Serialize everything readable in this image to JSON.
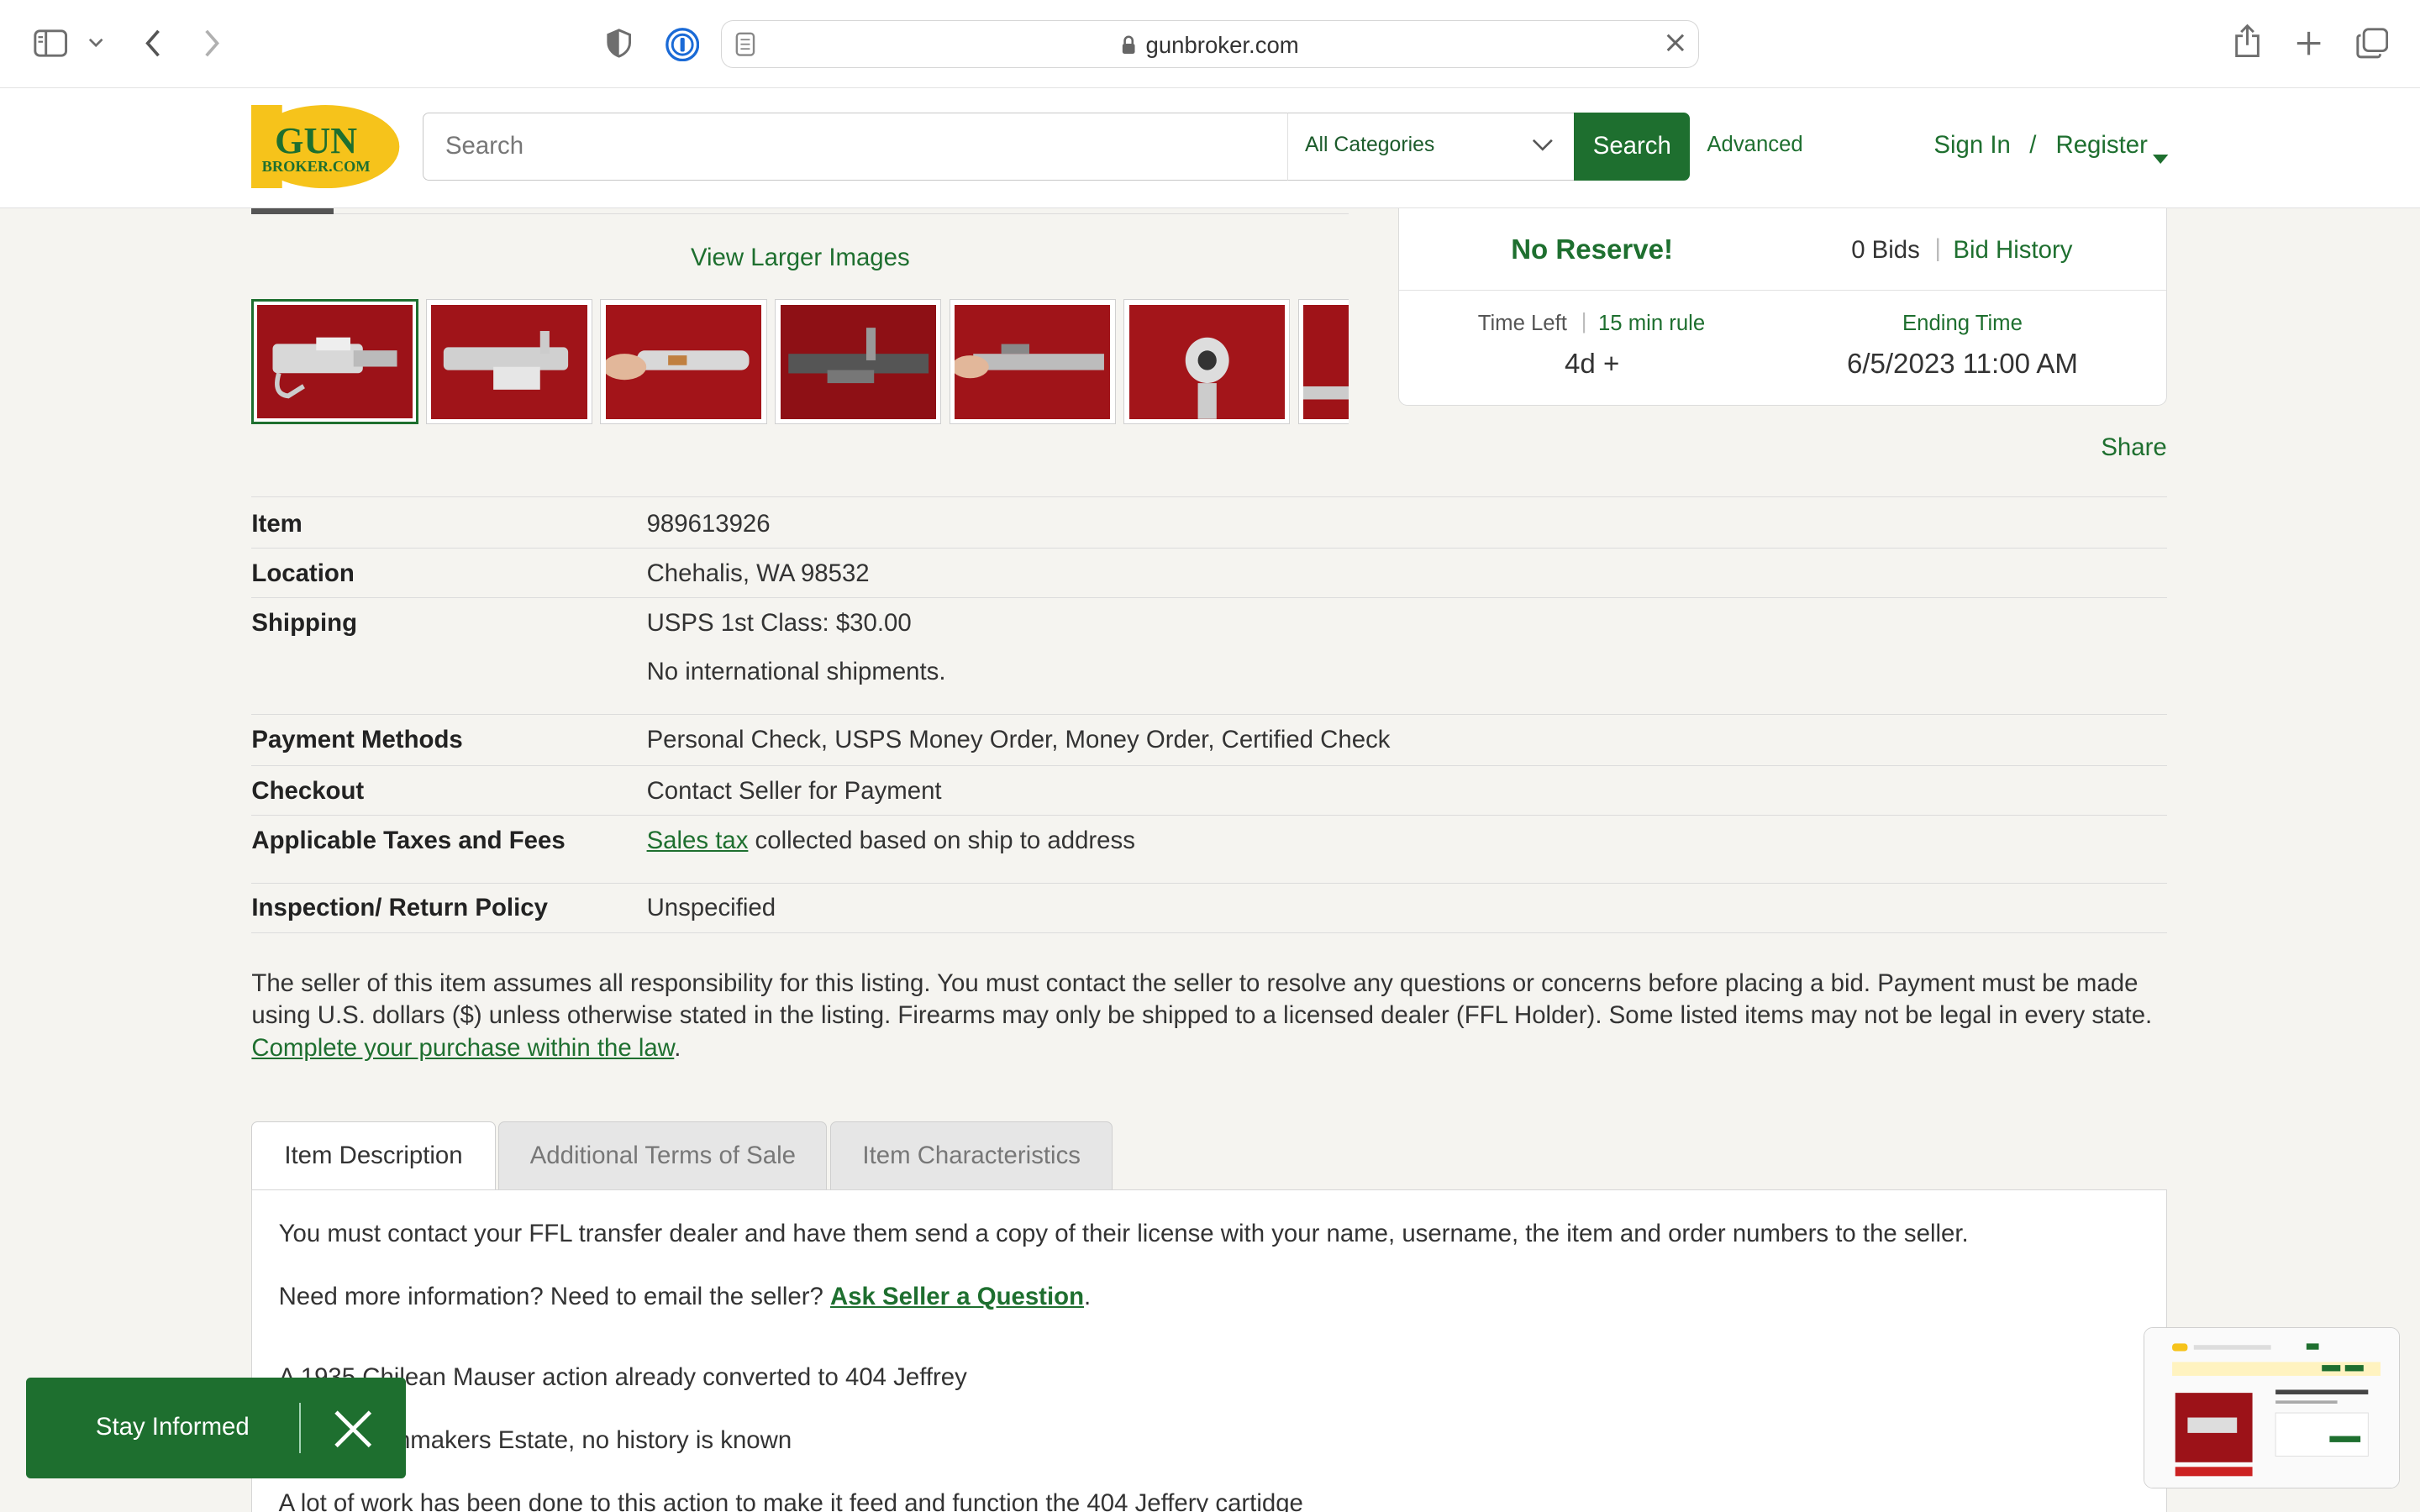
{
  "browser": {
    "url": "gunbroker.com",
    "icons": [
      "sidebar-icon",
      "chevron-down-icon",
      "back-icon",
      "forward-icon",
      "shield-icon",
      "password-icon",
      "page-icon",
      "lock-icon",
      "clear-icon",
      "share-icon",
      "plus-icon",
      "tabs-icon"
    ]
  },
  "header": {
    "logo_top": "GUN",
    "logo_bottom": "BROKER.COM",
    "search_placeholder": "Search",
    "category": "All Categories",
    "search_button": "Search",
    "advanced": "Advanced",
    "sign_in": "Sign In",
    "separator": "/",
    "register": "Register"
  },
  "gallery": {
    "view_larger": "View Larger Images",
    "thumb_count": 7
  },
  "bid": {
    "no_reserve": "No Reserve!",
    "bids": "0 Bids",
    "sep": "|",
    "bid_history": "Bid History",
    "time_left_label": "Time Left",
    "min_rule": "15 min rule",
    "time_left": "4d +",
    "ending_label": "Ending Time",
    "ending_time": "6/5/2023 11:00 AM"
  },
  "share": "Share",
  "details": {
    "item_label": "Item",
    "item_value": "989613926",
    "location_label": "Location",
    "location_value": "Chehalis, WA 98532",
    "shipping_label": "Shipping",
    "shipping_value": "USPS 1st Class: $30.00",
    "shipping_note": "No international shipments.",
    "payment_label": "Payment Methods",
    "payment_value": "Personal Check, USPS Money Order, Money Order, Certified Check",
    "checkout_label": "Checkout",
    "checkout_value": "Contact Seller for Payment",
    "taxes_label": "Applicable Taxes and Fees",
    "taxes_link": "Sales tax",
    "taxes_rest": " collected based on ship to address",
    "inspection_label": "Inspection/ Return Policy",
    "inspection_value": "Unspecified"
  },
  "disclaimer": {
    "text": "The seller of this item assumes all responsibility for this listing. You must contact the seller to resolve any questions or concerns before placing a bid. Payment must be made using U.S. dollars ($) unless otherwise stated in the listing. Firearms may only be shipped to a licensed dealer (FFL Holder). Some listed items may not be legal in every state. ",
    "link": "Complete your purchase within the law",
    "end": "."
  },
  "tabs": [
    "Item Description",
    "Additional Terms of Sale",
    "Item Characteristics"
  ],
  "description": {
    "ffl_note": "You must contact your FFL transfer dealer and have them send a copy of their license with your name, username, the item and order numbers to the seller.",
    "need_more": "Need more information? Need to email the seller? ",
    "ask_link": "Ask Seller a Question",
    "ask_end": ".",
    "line1": "A 1935 Chilean Mauser action already converted to 404 Jeffrey",
    "line2": "From a Gunmakers Estate, no history is known",
    "line3": "A lot of work has been done to this action to make it feed and function the 404 Jeffery cartidge"
  },
  "stay_informed": "Stay Informed",
  "colors": {
    "brand_green": "#1e6f2f",
    "logo_yellow": "#f6c31b",
    "page_bg": "#f5f4f0"
  }
}
